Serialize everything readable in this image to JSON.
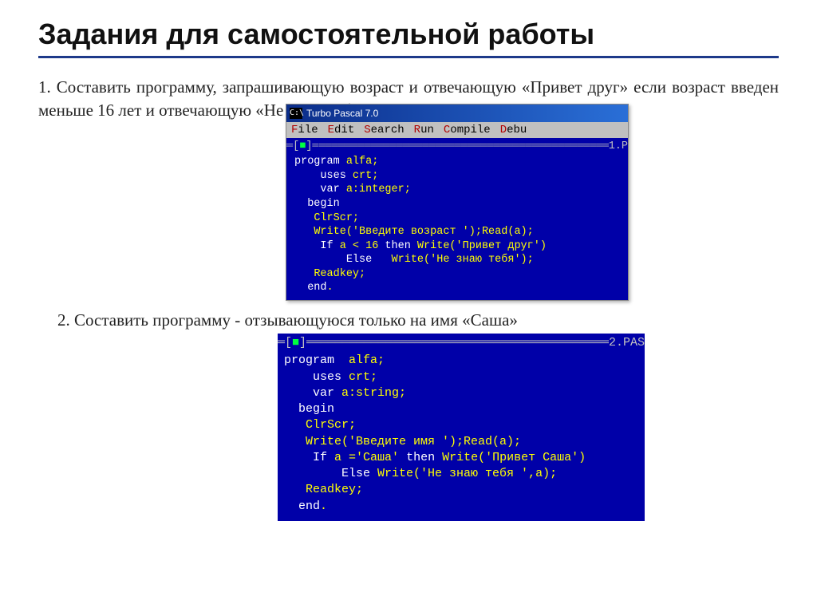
{
  "title": "Задания для самостоятельной работы",
  "task1_num": "1.",
  "task1_text": "Составить программу, запрашивающую возраст и отвечающую «Привет друг» если возраст введен меньше 16 лет и отвечающую «Не знаю тебя» в противном",
  "task2_num": "2.",
  "task2_text": "Составить  программу  -  отзывающуюся  только  на  имя «Саша»",
  "turbo": {
    "title": "Turbo Pascal 7.0",
    "sysicon": "C:\\",
    "menu": {
      "file": "File",
      "edit": "Edit",
      "search": "Search",
      "run": "Run",
      "compile": "Compile",
      "debug": "Debu"
    },
    "bracket_l": "═[",
    "green_box": "■",
    "bracket_r": "]═",
    "file1": "1.P",
    "file2": "2.PAS",
    "code1": {
      "l1": {
        "kw": "program",
        "rest": " alfa;"
      },
      "l2": {
        "pad": "    ",
        "kw": "uses",
        "rest": " crt;"
      },
      "l3": {
        "pad": "    ",
        "kw": "var",
        "rest": " a:integer;"
      },
      "l4": {
        "pad": "  ",
        "kw": "begin",
        "rest": ""
      },
      "l5": {
        "pad": "   ",
        "rest": "ClrScr;"
      },
      "l6": {
        "pad": "   ",
        "rest": "Write('Введите возраст ');Read(a);"
      },
      "l7": {
        "pad": "    ",
        "kw": "If",
        "rest": " a < 16 ",
        "kw2": "then",
        "rest2": " Write('Привет друг')"
      },
      "l8": {
        "pad": "        ",
        "kw": "Else",
        "rest": "   Write('Не знаю тебя');"
      },
      "l9": {
        "pad": "   ",
        "rest": "Readkey;"
      },
      "l10": {
        "pad": "  ",
        "kw": "end",
        "rest": "."
      }
    },
    "code2": {
      "l1": {
        "kw": "program",
        "rest": "  alfa;"
      },
      "l2": {
        "pad": "    ",
        "kw": "uses",
        "rest": " crt;"
      },
      "l3": {
        "pad": "    ",
        "kw": "var",
        "rest": " a:string;"
      },
      "l4": {
        "pad": "  ",
        "kw": "begin",
        "rest": ""
      },
      "l5": {
        "pad": "   ",
        "rest": "ClrScr;"
      },
      "l6": {
        "pad": "   ",
        "rest": "Write('Введите имя ');Read(a);"
      },
      "l7": {
        "pad": "    ",
        "kw": "If",
        "rest": " a ='Саша' ",
        "kw2": "then",
        "rest2": " Write('Привет Саша')"
      },
      "l8": {
        "pad": "        ",
        "kw": "Else",
        "rest": " Write('Не знаю тебя ',a);"
      },
      "l9": {
        "pad": "   ",
        "rest": "Readkey;"
      },
      "l10": {
        "pad": "  ",
        "kw": "end",
        "rest": "."
      }
    }
  }
}
